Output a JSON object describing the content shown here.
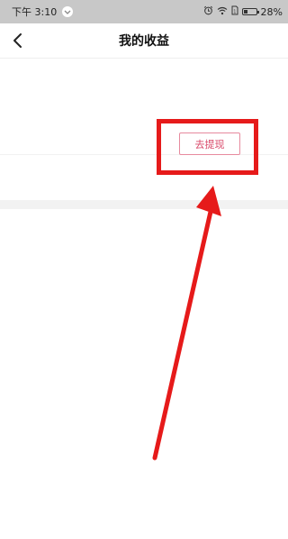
{
  "status_bar": {
    "time": "下午 3:10",
    "battery": "28%"
  },
  "header": {
    "title": "我的收益"
  },
  "card": {
    "withdraw_label": "去提现"
  },
  "colors": {
    "accent": "#d9496a",
    "annotation": "#e61a1a"
  },
  "icons": [
    "back-arrow-icon",
    "notification-icon",
    "alarm-icon",
    "wifi-icon",
    "sim-icon",
    "battery-icon"
  ]
}
